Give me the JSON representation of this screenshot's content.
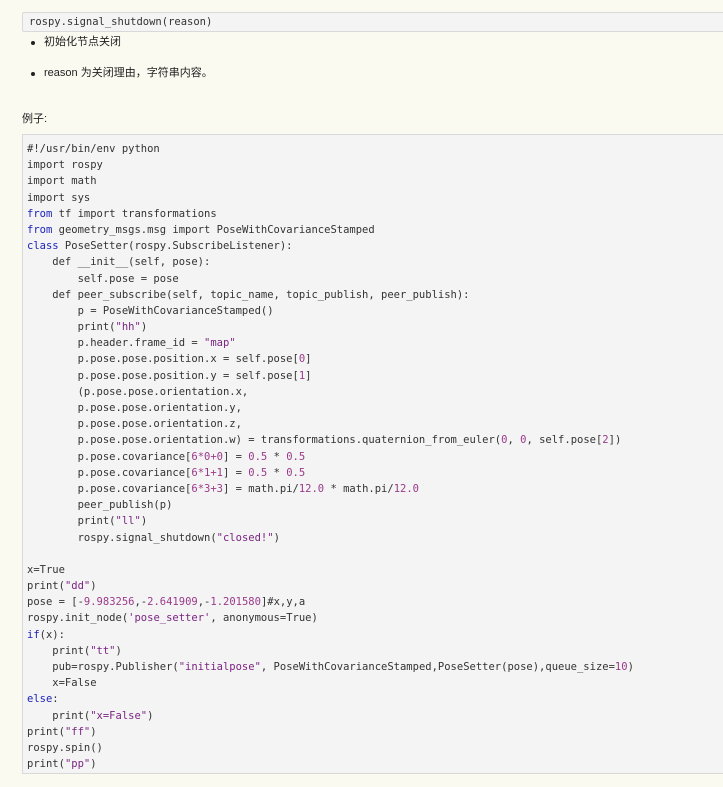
{
  "signature": "rospy.signal_shutdown(reason)",
  "bullets": [
    "初始化节点关闭",
    "reason 为关闭理由，字符串内容。"
  ],
  "example_label": "例子:",
  "code_lines": [
    [
      [
        "#!/usr/bin/env python",
        "p"
      ]
    ],
    [
      [
        "import rospy",
        "p"
      ]
    ],
    [
      [
        "import math",
        "p"
      ]
    ],
    [
      [
        "import sys",
        "p"
      ]
    ],
    [
      [
        "from",
        "k"
      ],
      [
        " tf import transformations",
        "p"
      ]
    ],
    [
      [
        "from",
        "k"
      ],
      [
        " geometry_msgs.msg import PoseWithCovarianceStamped",
        "p"
      ]
    ],
    [
      [
        "class",
        "k"
      ],
      [
        " PoseSetter(rospy.SubscribeListener):",
        "p"
      ]
    ],
    [
      [
        "    def __init__(self, pose):",
        "p"
      ]
    ],
    [
      [
        "        self.pose = pose",
        "p"
      ]
    ],
    [
      [
        "    def peer_subscribe(self, topic_name, topic_publish, peer_publish):",
        "p"
      ]
    ],
    [
      [
        "        p = PoseWithCovarianceStamped()",
        "p"
      ]
    ],
    [
      [
        "        print(",
        "p"
      ],
      [
        "\"hh\"",
        "s"
      ],
      [
        ")",
        "p"
      ]
    ],
    [
      [
        "        p.header.frame_id = ",
        "p"
      ],
      [
        "\"map\"",
        "s"
      ]
    ],
    [
      [
        "        p.pose.pose.position.x = self.pose[",
        "p"
      ],
      [
        "0",
        "n"
      ],
      [
        "]",
        "p"
      ]
    ],
    [
      [
        "        p.pose.pose.position.y = self.pose[",
        "p"
      ],
      [
        "1",
        "n"
      ],
      [
        "]",
        "p"
      ]
    ],
    [
      [
        "        (p.pose.pose.orientation.x,",
        "p"
      ]
    ],
    [
      [
        "        p.pose.pose.orientation.y,",
        "p"
      ]
    ],
    [
      [
        "        p.pose.pose.orientation.z,",
        "p"
      ]
    ],
    [
      [
        "        p.pose.pose.orientation.w) = transformations.quaternion_from_euler(",
        "p"
      ],
      [
        "0",
        "n"
      ],
      [
        ", ",
        "p"
      ],
      [
        "0",
        "n"
      ],
      [
        ", self.pose[",
        "p"
      ],
      [
        "2",
        "n"
      ],
      [
        "])",
        "p"
      ]
    ],
    [
      [
        "        p.pose.covariance[",
        "p"
      ],
      [
        "6*0+0",
        "n"
      ],
      [
        "] = ",
        "p"
      ],
      [
        "0.5",
        "n"
      ],
      [
        " * ",
        "p"
      ],
      [
        "0.5",
        "n"
      ]
    ],
    [
      [
        "        p.pose.covariance[",
        "p"
      ],
      [
        "6*1+1",
        "n"
      ],
      [
        "] = ",
        "p"
      ],
      [
        "0.5",
        "n"
      ],
      [
        " * ",
        "p"
      ],
      [
        "0.5",
        "n"
      ]
    ],
    [
      [
        "        p.pose.covariance[",
        "p"
      ],
      [
        "6*3+3",
        "n"
      ],
      [
        "] = math.pi/",
        "p"
      ],
      [
        "12.0",
        "n"
      ],
      [
        " * math.pi/",
        "p"
      ],
      [
        "12.0",
        "n"
      ]
    ],
    [
      [
        "        peer_publish(p)",
        "p"
      ]
    ],
    [
      [
        "        print(",
        "p"
      ],
      [
        "\"ll\"",
        "s"
      ],
      [
        ")",
        "p"
      ]
    ],
    [
      [
        "        rospy.signal_shutdown(",
        "p"
      ],
      [
        "\"closed!\"",
        "s"
      ],
      [
        ")",
        "p"
      ]
    ],
    [],
    [
      [
        "x=True",
        "p"
      ]
    ],
    [
      [
        "print(",
        "p"
      ],
      [
        "\"dd\"",
        "s"
      ],
      [
        ")",
        "p"
      ]
    ],
    [
      [
        "pose = [-",
        "p"
      ],
      [
        "9.983256",
        "n"
      ],
      [
        ",-",
        "p"
      ],
      [
        "2.641909",
        "n"
      ],
      [
        ",-",
        "p"
      ],
      [
        "1.201580",
        "n"
      ],
      [
        "]#x,y,a",
        "p"
      ]
    ],
    [
      [
        "rospy.init_node(",
        "p"
      ],
      [
        "'pose_setter'",
        "s"
      ],
      [
        ", anonymous=True)",
        "p"
      ]
    ],
    [
      [
        "if",
        "k"
      ],
      [
        "(x):",
        "p"
      ]
    ],
    [
      [
        "    print(",
        "p"
      ],
      [
        "\"tt\"",
        "s"
      ],
      [
        ")",
        "p"
      ]
    ],
    [
      [
        "    pub=rospy.Publisher(",
        "p"
      ],
      [
        "\"initialpose\"",
        "s"
      ],
      [
        ", PoseWithCovarianceStamped,PoseSetter(pose),queue_size=",
        "p"
      ],
      [
        "10",
        "n"
      ],
      [
        ")",
        "p"
      ]
    ],
    [
      [
        "    x=False",
        "p"
      ]
    ],
    [
      [
        "else",
        "k"
      ],
      [
        ":",
        "p"
      ]
    ],
    [
      [
        "    print(",
        "p"
      ],
      [
        "\"x=False\"",
        "s"
      ],
      [
        ")",
        "p"
      ]
    ],
    [
      [
        "print(",
        "p"
      ],
      [
        "\"ff\"",
        "s"
      ],
      [
        ")",
        "p"
      ]
    ],
    [
      [
        "rospy.spin()",
        "p"
      ]
    ],
    [
      [
        "print(",
        "p"
      ],
      [
        "\"pp\"",
        "s"
      ],
      [
        ")",
        "p"
      ]
    ]
  ]
}
